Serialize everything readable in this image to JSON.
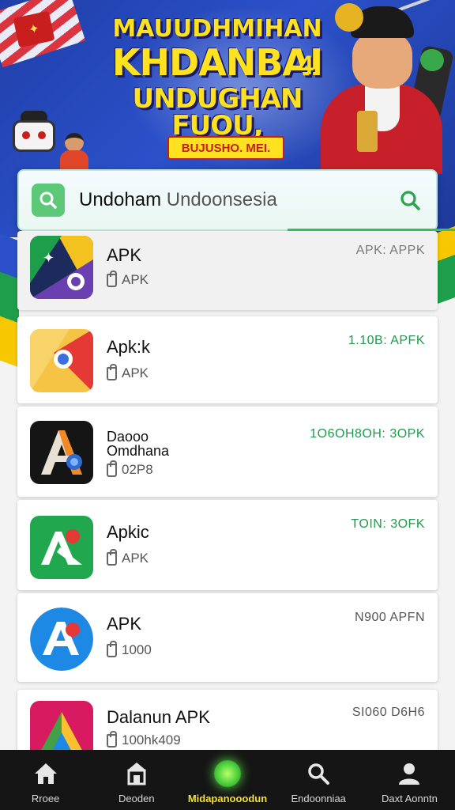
{
  "banner": {
    "headline_line1": "MAUUDHMIHAN",
    "headline_line2": "KHDANBAI",
    "headline_line3": "UNDUGHAN FUOU,",
    "headline_badge": "4",
    "sub_badge": "BUJUSHO. MEI."
  },
  "search": {
    "value_primary": "Undoham",
    "value_secondary": " Undoonsesia"
  },
  "apps": [
    {
      "title": "APK",
      "subtitle": "APK",
      "meta": "APK: APPK",
      "meta_color": "grey"
    },
    {
      "title": "Apk:k",
      "subtitle": "APK",
      "meta": "1.10B: APFK",
      "meta_color": "green"
    },
    {
      "title": "Daooo",
      "title2": "Omdhana",
      "subtitle": "02P8",
      "meta": "1O6OH8OH: 3OPK",
      "meta_color": "green"
    },
    {
      "title": "Apkic",
      "subtitle": "APK",
      "meta": "TOIN: 3OFK",
      "meta_color": "green"
    },
    {
      "title": "APK",
      "subtitle": "1000",
      "meta": "N900 APFN",
      "meta_color": "dark"
    },
    {
      "title": "Dalanun APK",
      "subtitle": "100hk409",
      "meta": "SI060 D6H6",
      "meta_color": "dark"
    }
  ],
  "nav": [
    {
      "label": "Rroee",
      "icon": "home-icon"
    },
    {
      "label": "Deoden",
      "icon": "store-icon"
    },
    {
      "label": "Midapanooodun",
      "icon": "active-dot-icon"
    },
    {
      "label": "Endoonniaa",
      "icon": "search-icon"
    },
    {
      "label": "Daxt Aonntn",
      "icon": "user-icon"
    }
  ],
  "colors": {
    "accent_green": "#1f9a4c",
    "banner_blue": "#2b50c9",
    "headline_yellow": "#ffe21f",
    "nav_bg": "#151515"
  }
}
